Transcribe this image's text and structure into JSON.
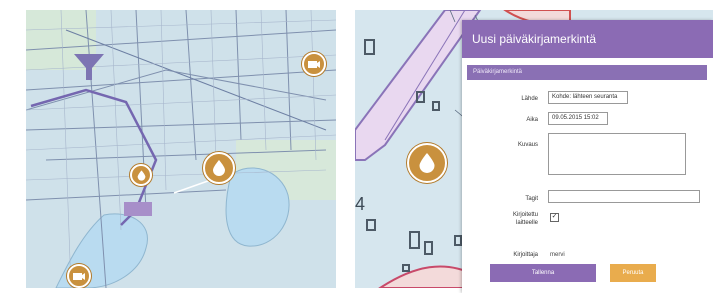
{
  "colors": {
    "brand_purple": "#8b6bb4",
    "marker_orange": "#c9913e",
    "cancel_orange": "#e9ac4d",
    "water_blue": "#b9dbf0"
  },
  "left_map": {
    "markers": [
      {
        "name": "water-drop-marker-large",
        "icon": "water-drop-icon"
      },
      {
        "name": "water-drop-marker-small",
        "icon": "water-drop-icon"
      },
      {
        "name": "camera-marker-top-right",
        "icon": "camera-icon"
      },
      {
        "name": "camera-marker-bottom-left",
        "icon": "camera-icon"
      }
    ],
    "filter_icon": "funnel-icon"
  },
  "right_map": {
    "marker_icon": "water-drop-icon"
  },
  "dialog": {
    "title": "Uusi päiväkirjamerkintä",
    "section_title": "Päiväkirjamerkintä",
    "fields": {
      "category_label": "Lähde",
      "category_value": "Kohde: lähteen seuranta",
      "time_label": "Aika",
      "time_value": "09.05.2015 15:02",
      "description_label": "Kuvaus",
      "description_value": "",
      "tags_label": "Tagit",
      "tags_value": "",
      "written_label": "Kirjoitettu laitteelle",
      "written_checked": "✓",
      "author_label": "Kirjoittaja",
      "author_value": "mervi"
    },
    "save_label": "Tallenna",
    "cancel_label": "Peruuta"
  }
}
